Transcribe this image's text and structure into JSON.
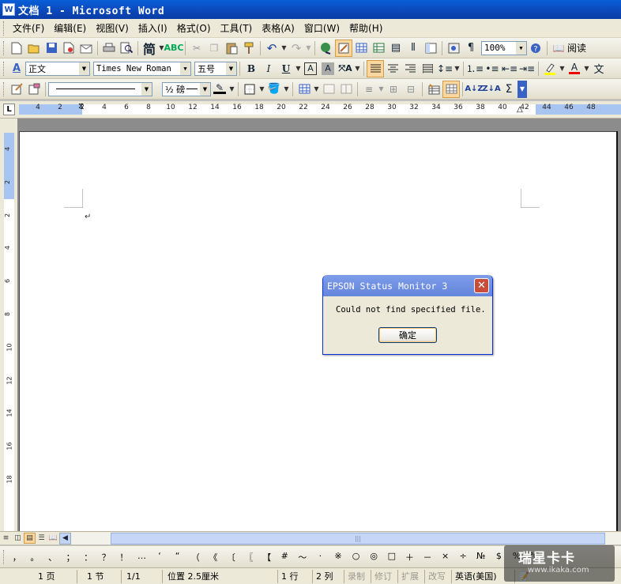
{
  "window": {
    "title": "文档 1 - Microsoft Word"
  },
  "menu": [
    "文件(F)",
    "编辑(E)",
    "视图(V)",
    "插入(I)",
    "格式(O)",
    "工具(T)",
    "表格(A)",
    "窗口(W)",
    "帮助(H)"
  ],
  "toolbar_standard": {
    "zoom": "100%",
    "read_label": "阅读"
  },
  "toolbar_format": {
    "style": "正文",
    "font": "Times New Roman",
    "size": "五号"
  },
  "toolbar_tables": {
    "line_weight": "½ 磅"
  },
  "ruler_h": {
    "labels": [
      "4",
      "2",
      "2",
      "4",
      "6",
      "8",
      "10",
      "12",
      "14",
      "16",
      "18",
      "20",
      "22",
      "24",
      "26",
      "28",
      "30",
      "32",
      "34",
      "36",
      "38",
      "40",
      "42",
      "44",
      "46",
      "48"
    ],
    "corner": "L"
  },
  "ruler_v": {
    "labels": [
      "4",
      "2",
      "2",
      "4",
      "6",
      "8",
      "10",
      "12",
      "14",
      "16",
      "18"
    ]
  },
  "document": {
    "paragraph_mark": "↵"
  },
  "dialog": {
    "title": "EPSON Status Monitor 3",
    "message": "Could not find specified file.",
    "ok_label": "确定"
  },
  "symbols": [
    "，",
    "。",
    "、",
    "；",
    "：",
    "？",
    "！",
    "…",
    "‘",
    "“",
    "（",
    "《",
    "〔",
    "〖",
    "【",
    "#",
    "～",
    "·",
    "※",
    "○",
    "◎",
    "□",
    "＋",
    "－",
    "×",
    "÷",
    "№",
    "$",
    "%",
    "℃"
  ],
  "status": {
    "page": "1 页",
    "section": "1 节",
    "pages": "1/1",
    "position": "位置 2.5厘米",
    "line": "1 行",
    "column": "2 列",
    "rec": "录制",
    "trk": "修订",
    "ext": "扩展",
    "ovr": "改写",
    "language": "英语(美国)"
  },
  "watermark": {
    "line1": "瑞星卡卡",
    "line2": "www.ikaka.com"
  },
  "colors": {
    "title_blue": "#0b47b8",
    "dialog_title": "#7090e2",
    "close_red": "#c84d3b",
    "ruler_blue": "#a8c4f0"
  }
}
